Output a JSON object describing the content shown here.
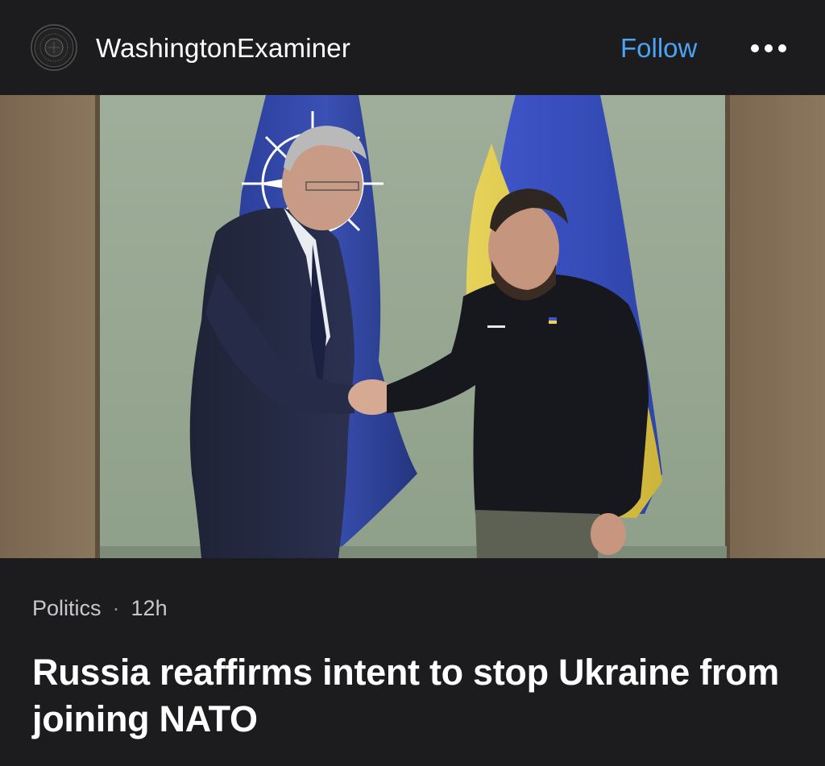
{
  "header": {
    "source_name": "WashingtonExaminer",
    "follow_label": "Follow",
    "more_icon": "more-horizontal-icon",
    "accent_color": "#4aa3f3"
  },
  "photo": {
    "subject": "NATO and Ukraine officials shaking hands in front of flags"
  },
  "article": {
    "category": "Politics",
    "separator": "·",
    "age": "12h",
    "headline": "Russia reaffirms intent to stop Ukraine from joining NATO"
  }
}
